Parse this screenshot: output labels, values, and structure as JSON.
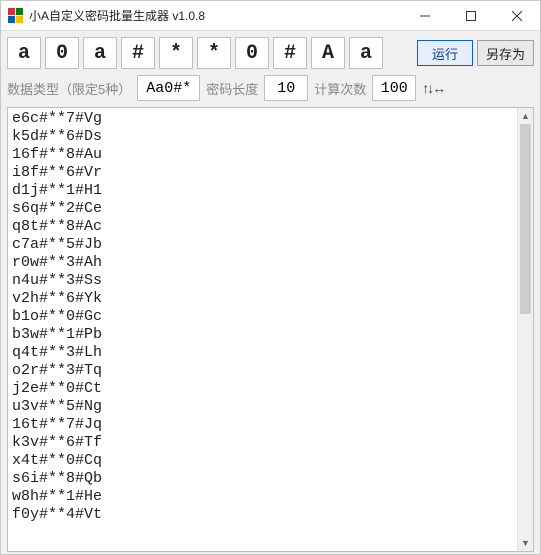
{
  "window": {
    "title": "小A自定义密码批量生成器 v1.0.8"
  },
  "toolbar": {
    "tokens": [
      "a",
      "0",
      "a",
      "#",
      "*",
      "*",
      "0",
      "#",
      "A",
      "a"
    ],
    "run_label": "运行",
    "saveas_label": "另存为"
  },
  "params": {
    "data_type_label": "数据类型（限定5种）",
    "data_type_value": "Aa0#*",
    "length_label": "密码长度",
    "length_value": "10",
    "count_label": "计算次数",
    "count_value": "100",
    "arrows": "↑↓↔"
  },
  "output_lines": [
    "e6c#**7#Vg",
    "k5d#**6#Ds",
    "16f#**8#Au",
    "i8f#**6#Vr",
    "d1j#**1#H1",
    "s6q#**2#Ce",
    "q8t#**8#Ac",
    "c7a#**5#Jb",
    "r0w#**3#Ah",
    "n4u#**3#Ss",
    "v2h#**6#Yk",
    "b1o#**0#Gc",
    "b3w#**1#Pb",
    "q4t#**3#Lh",
    "o2r#**3#Tq",
    "j2e#**0#Ct",
    "u3v#**5#Ng",
    "16t#**7#Jq",
    "k3v#**6#Tf",
    "x4t#**0#Cq",
    "s6i#**8#Qb",
    "w8h#**1#He",
    "f0y#**4#Vt"
  ]
}
